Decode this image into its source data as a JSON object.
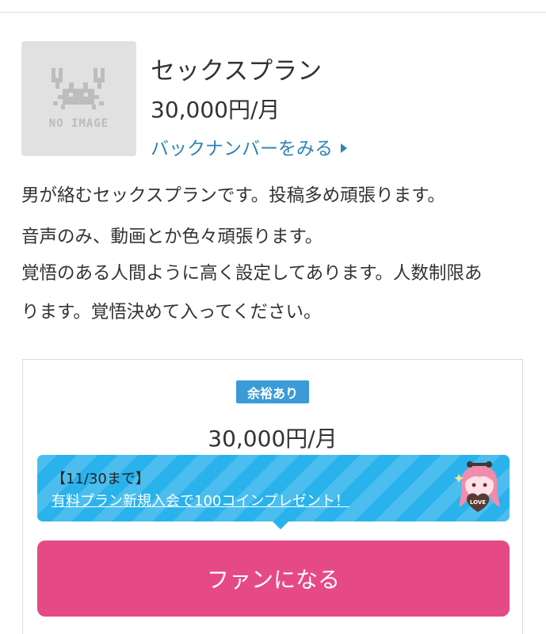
{
  "plan": {
    "thumbnail_text": "NO IMAGE",
    "title": "セックスプラン",
    "price": "30,000円/月",
    "backnumber_link": "バックナンバーをみる"
  },
  "description": [
    "男が絡むセックスプランです。投稿多め頑張ります。",
    "音声のみ、動画とか色々頑張ります。",
    "覚悟のある人間ように高く設定してあります。人数制限あ",
    "ります。覚悟決めて入ってください。"
  ],
  "card": {
    "status_badge": "余裕あり",
    "price": "30,000円/月",
    "promo_tag": "【11/30まで】",
    "promo_link": "有料プラン新規入会で100コインプレゼント！",
    "mascot_label": "LOVE",
    "join_button": "ファンになる"
  },
  "colors": {
    "link": "#2d84b8",
    "badge": "#3b9bd9",
    "promo_bg": "#29b2ec",
    "join_button": "#e64a86"
  }
}
